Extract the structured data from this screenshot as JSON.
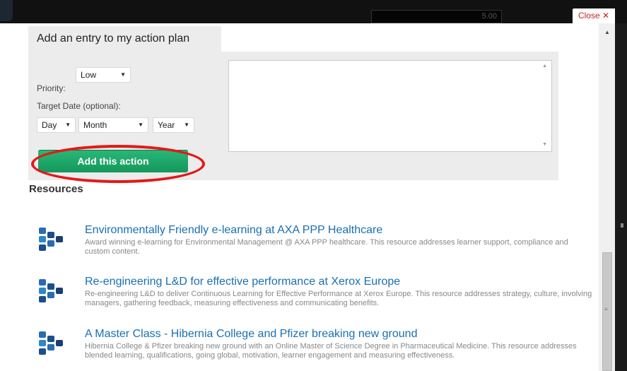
{
  "backdrop": {
    "bar_value": "5.00"
  },
  "modal": {
    "close_label": "Close ✕"
  },
  "form": {
    "title": "Add an entry to my action plan",
    "priority_label": "Priority:",
    "priority_value": "Low",
    "target_date_label": "Target Date (optional):",
    "day_value": "Day",
    "month_value": "Month",
    "year_value": "Year",
    "notes_value": "",
    "submit_label": "Add this action"
  },
  "resources": {
    "heading": "Resources",
    "items": [
      {
        "title": "Environmentally Friendly e-learning at AXA PPP Healthcare",
        "description": "Award winning e-learning for Environmental Management @ AXA PPP healthcare. This resource addresses learner support, compliance and custom content."
      },
      {
        "title": "Re-engineering L&D for effective performance at Xerox Europe",
        "description": "Re-engineering L&D to deliver Continuous Learning for Effective Performance at Xerox Europe. This resource addresses strategy, culture, involving managers, gathering feedback, measuring effectiveness and communicating benefits."
      },
      {
        "title": "A Master Class - Hibernia College and Pfizer breaking new ground",
        "description": "Hibernia College & Pfizer breaking new ground with an Online Master of Science Degree in Pharmaceutical Medicine. This resource addresses blended learning, qualifications, going global, motivation, learner engagement and measuring effectiveness."
      }
    ]
  },
  "colors": {
    "accent_green": "#1aa86a",
    "link_blue": "#1a6fb3",
    "highlight_red": "#e41818",
    "close_red": "#cc2222"
  }
}
